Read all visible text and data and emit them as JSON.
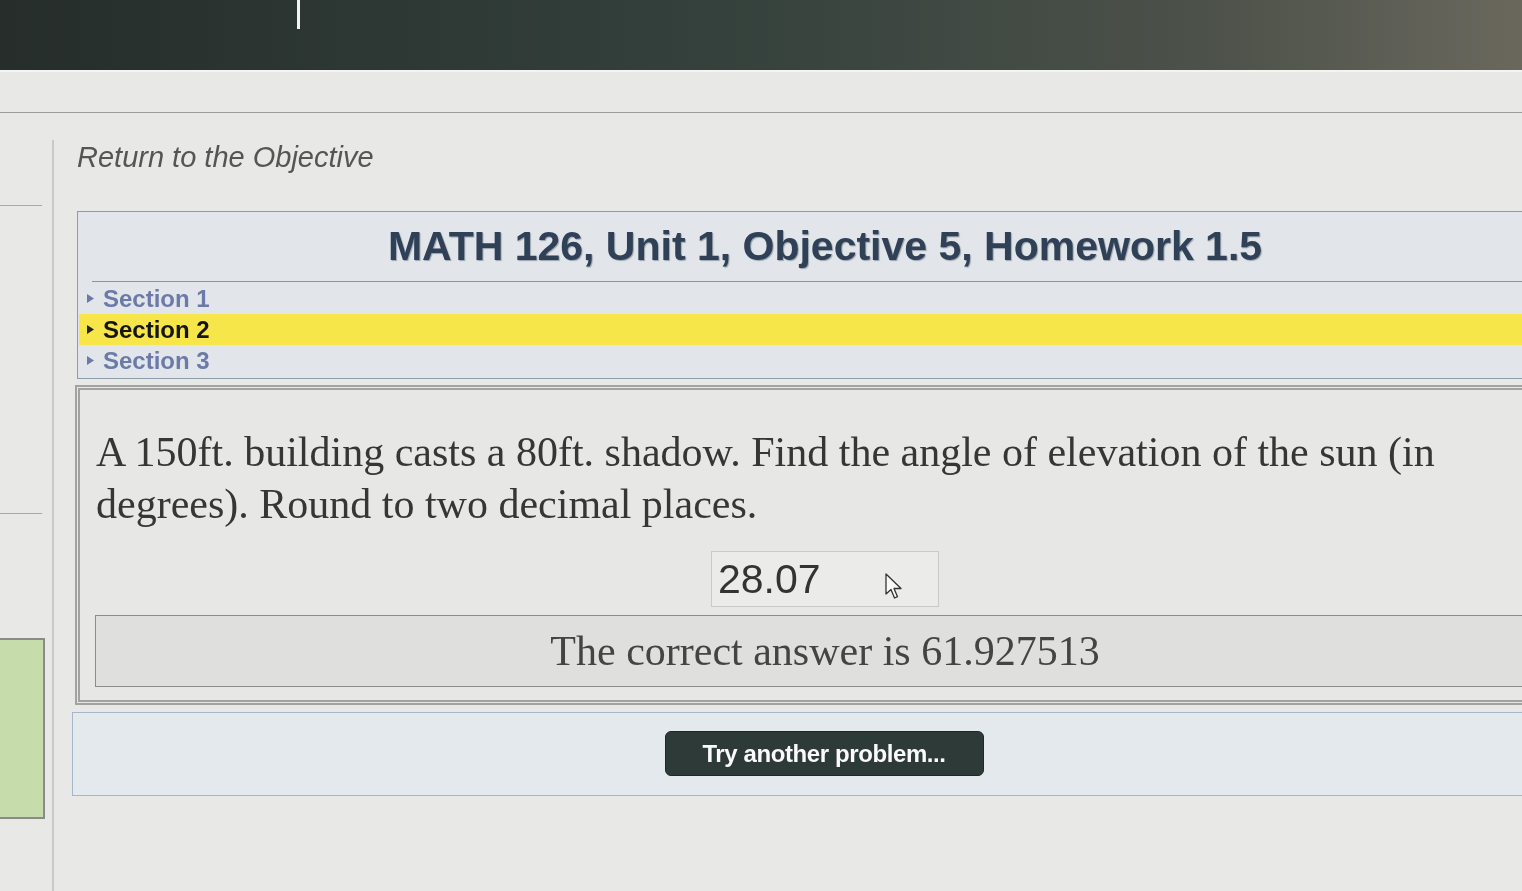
{
  "return_link": "Return to the Objective",
  "homework": {
    "title": "MATH 126, Unit 1, Objective 5, Homework 1.5",
    "sections": [
      {
        "label": "Section 1",
        "selected": false
      },
      {
        "label": "Section 2",
        "selected": true
      },
      {
        "label": "Section 3",
        "selected": false
      }
    ]
  },
  "problem": {
    "question": "A 150ft. building casts a 80ft. shadow. Find the angle of elevation of the sun (in degrees). Round to two decimal places.",
    "answer": {
      "value": "28.07"
    },
    "feedback": "The correct answer is 61.927513"
  },
  "try_another_button": "Try another problem..."
}
